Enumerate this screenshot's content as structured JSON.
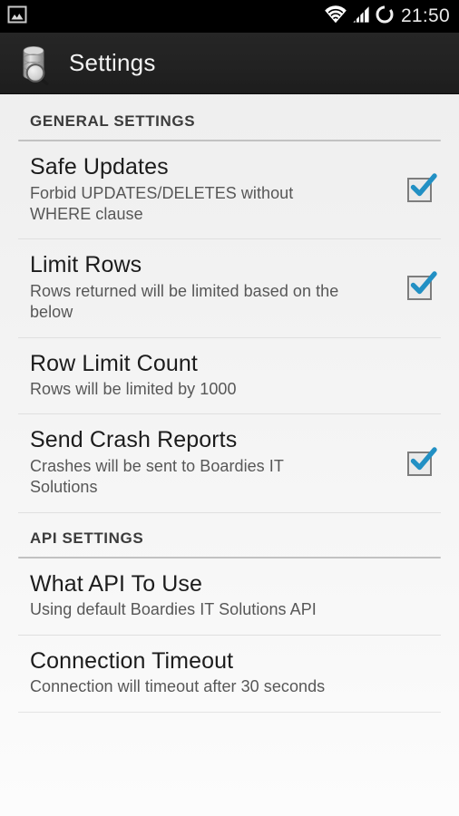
{
  "status_bar": {
    "left_icons": [
      {
        "name": "gallery-photo-icon",
        "glyph": "photo"
      }
    ],
    "right_icons": [
      {
        "name": "wifi-icon",
        "glyph": "wifi"
      },
      {
        "name": "cellular-signal-icon",
        "glyph": "signal"
      },
      {
        "name": "sync-circle-icon",
        "glyph": "circle"
      }
    ],
    "clock": "21:50",
    "background_color": "#000000",
    "text_color": "#e8e8e8"
  },
  "action_bar": {
    "icon_name": "database-search-icon",
    "title": "Settings",
    "background_color": "#222222",
    "title_color": "#f4f4f4"
  },
  "accent_color": "#2290c4",
  "sections": [
    {
      "header": "GENERAL SETTINGS",
      "items": [
        {
          "key": "safe-updates",
          "title": "Safe Updates",
          "summary": "Forbid UPDATES/DELETES without WHERE clause",
          "widget": "checkbox",
          "checked": true
        },
        {
          "key": "limit-rows",
          "title": "Limit Rows",
          "summary": "Rows returned will be limited based on the below",
          "widget": "checkbox",
          "checked": true
        },
        {
          "key": "row-limit-count",
          "title": "Row Limit Count",
          "summary": "Rows will be limited by 1000",
          "widget": "none",
          "checked": false
        },
        {
          "key": "send-crash-reports",
          "title": "Send Crash Reports",
          "summary": "Crashes will be sent to Boardies IT Solutions",
          "widget": "checkbox",
          "checked": true
        }
      ]
    },
    {
      "header": "API SETTINGS",
      "items": [
        {
          "key": "what-api-to-use",
          "title": "What API To Use",
          "summary": "Using default Boardies IT Solutions API",
          "widget": "none",
          "checked": false
        },
        {
          "key": "connection-timeout",
          "title": "Connection Timeout",
          "summary": "Connection will timeout after 30 seconds",
          "widget": "none",
          "checked": false
        }
      ]
    }
  ]
}
